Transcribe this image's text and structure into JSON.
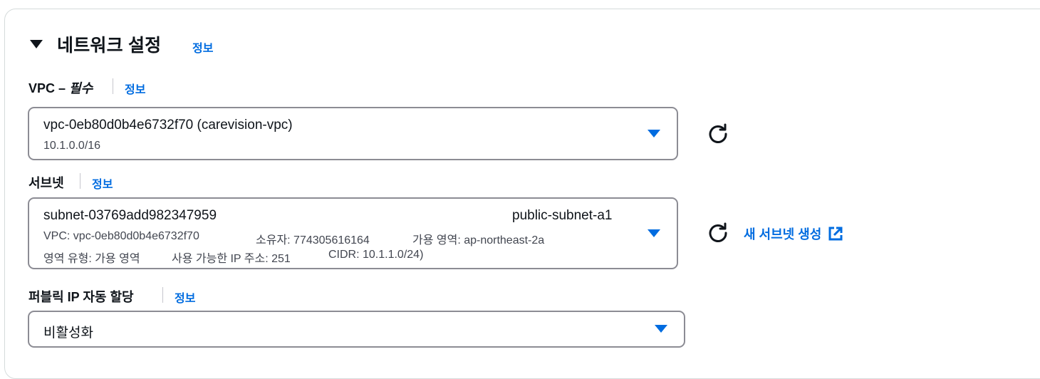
{
  "section": {
    "title": "네트워크 설정",
    "info": "정보"
  },
  "vpc": {
    "label": "VPC",
    "dash": " – ",
    "required": "필수",
    "info": "정보",
    "selected": "vpc-0eb80d0b4e6732f70 (carevision-vpc)",
    "cidr": "10.1.0.0/16"
  },
  "subnet": {
    "label": "서브넷",
    "info": "정보",
    "id": "subnet-03769add982347959",
    "name": "public-subnet-a1",
    "detail_1a": "VPC: vpc-0eb80d0b4e6732f70",
    "detail_1b": "소유자: 774305616164",
    "detail_1c": "가용 영역: ap-northeast-2a",
    "detail_2a": "영역 유형: 가용 영역",
    "detail_2b": "사용 가능한 IP 주소: 251",
    "detail_2c": "CIDR: 10.1.1.0/24)",
    "create_link": "새 서브넷 생성"
  },
  "public_ip": {
    "label": "퍼블릭 IP 자동 할당",
    "info": "정보",
    "selected": "비활성화"
  },
  "colors": {
    "link": "#006ce0",
    "text": "#0f141a",
    "secondary_text": "#424650",
    "select_border": "#8c8c94",
    "panel_border": "#d5dbdb"
  },
  "icons": [
    "caret-down-icon",
    "refresh-icon",
    "dropdown-arrow-icon",
    "external-link-icon"
  ]
}
